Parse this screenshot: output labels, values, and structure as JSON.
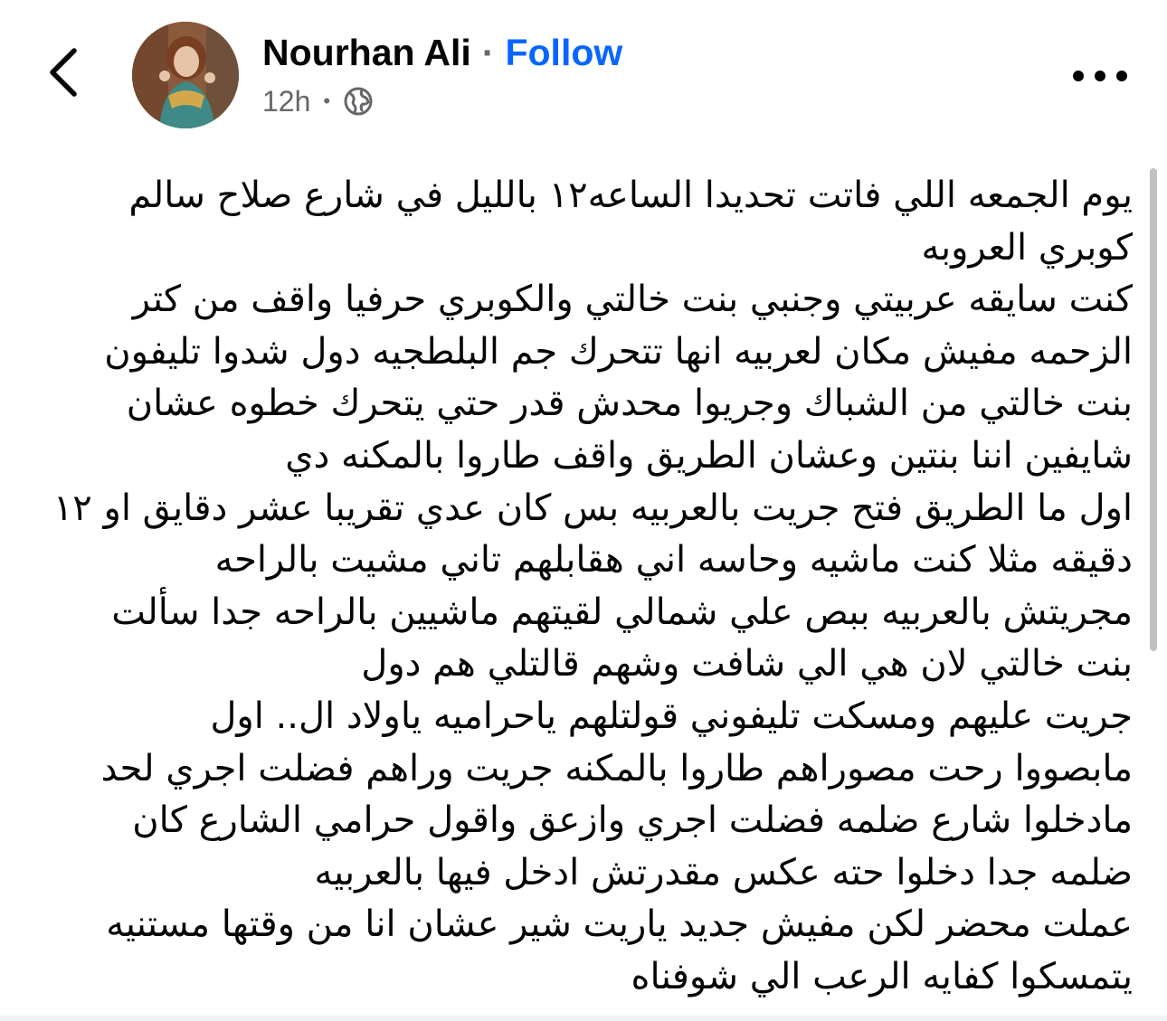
{
  "header": {
    "author_name": "Nourhan Ali",
    "separator": "·",
    "follow_label": "Follow",
    "timestamp": "12h",
    "meta_separator": "•",
    "audience_icon": "globe-icon",
    "back_icon": "chevron-left-icon",
    "more_icon": "more-horizontal-icon",
    "avatar_icon": "profile-photo"
  },
  "post": {
    "lines": [
      "يوم الجمعه اللي فاتت تحديدا الساعه١٢ بالليل  في شارع صلاح سالم",
      "كوبري العروبه",
      "كنت سايقه عربيتي وجنبي بنت خالتي والكوبري حرفيا واقف من كتر",
      "الزحمه مفيش مكان لعربيه انها تتحرك جم البلطجيه دول شدوا تليفون",
      "بنت خالتي من الشباك وجريوا محدش قدر حتي يتحرك خطوه عشان",
      "شايفين اننا بنتين وعشان الطريق واقف طاروا بالمكنه دي",
      "اول ما الطريق فتح جريت بالعربيه بس كان عدي تقريبا عشر دقايق او ١٢",
      "دقيقه مثلا  كنت ماشيه وحاسه اني هقابلهم تاني مشيت بالراحه",
      "مجريتش بالعربيه ببص علي شمالي لقيتهم ماشيين بالراحه جدا سألت",
      "بنت خالتي لان هي الي شافت وشهم قالتلي هم دول",
      "جريت عليهم ومسكت تليفوني قولتلهم ياحراميه ياولاد ال.. اول",
      "مابصووا رحت مصوراهم طاروا بالمكنه جريت وراهم فضلت اجري لحد",
      "مادخلوا شارع ضلمه فضلت اجري وازعق واقول حرامي الشارع كان",
      "ضلمه جدا دخلوا حته عكس مقدرتش ادخل فيها بالعربيه",
      "عملت محضر لكن مفيش جديد ياريت شير عشان انا من وقتها مستنيه",
      "يتمسكوا كفايه الرعب الي شوفناه"
    ]
  },
  "colors": {
    "follow": "#0866ff",
    "meta_text": "#65676b",
    "body_text": "#050505",
    "scrollbar": "#c1c1c1"
  }
}
